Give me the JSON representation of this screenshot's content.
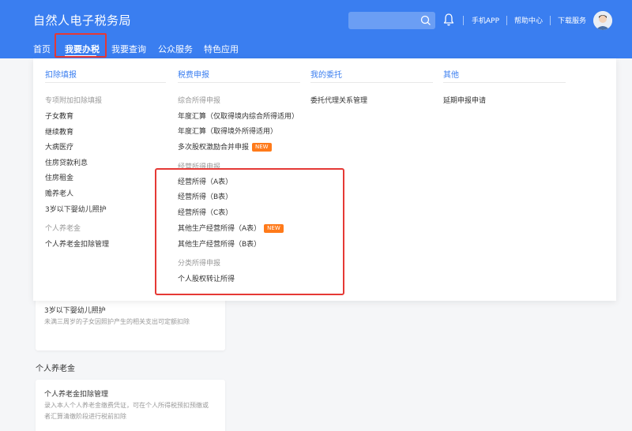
{
  "header": {
    "brand": "自然人电子税务局",
    "search_placeholder": "",
    "links": [
      "手机APP",
      "帮助中心",
      "下载服务"
    ],
    "accent_color": "#3a7ef0"
  },
  "nav": {
    "items": [
      "首页",
      "我要办税",
      "我要查询",
      "公众服务",
      "特色应用"
    ],
    "active_index": 1
  },
  "dropdown": {
    "columns": [
      {
        "header": "扣除填报",
        "groups": [
          {
            "title": "专项附加扣除填报",
            "items": [
              "子女教育",
              "继续教育",
              "大病医疗",
              "住房贷款利息",
              "住房租金",
              "赡养老人",
              "3岁以下婴幼儿照护"
            ]
          },
          {
            "title": "个人养老金",
            "items": [
              "个人养老金扣除管理"
            ]
          }
        ]
      },
      {
        "header": "税费申报",
        "groups": [
          {
            "title": "综合所得申报",
            "items": [
              "年度汇算（仅取得境内综合所得适用）",
              "年度汇算（取得境外所得适用）",
              "多次股权激励合并申报"
            ]
          },
          {
            "title": "经营所得申报",
            "items": [
              "经营所得（A表）",
              "经营所得（B表）",
              "经营所得（C表）",
              "其他生产经营所得（A表）",
              "其他生产经营所得（B表）"
            ]
          },
          {
            "title": "分类所得申报",
            "items": [
              "个人股权转让所得"
            ]
          }
        ]
      },
      {
        "header": "我的委托",
        "groups": [
          {
            "title": "",
            "items": [
              "委托代理关系管理"
            ]
          }
        ]
      },
      {
        "header": "其他",
        "groups": [
          {
            "title": "",
            "items": [
              "延期申报申请"
            ]
          }
        ]
      }
    ],
    "new_badge": "NEW"
  },
  "background": {
    "card1": {
      "title": "3岁以下婴幼儿照护",
      "desc": "未满三周岁的子女因照护产生的相关支出可定额扣除"
    },
    "section": "个人养老金",
    "card2": {
      "title": "个人养老金扣除管理",
      "desc": "录入本人个人养老金缴费凭证，可在个人所得税预扣预缴或者汇算清缴阶段进行税前扣除"
    }
  }
}
